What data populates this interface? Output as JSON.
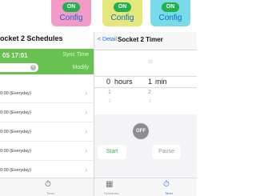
{
  "config_tiles": [
    {
      "toggle": "ON",
      "label": "Config",
      "color": "#f49ac9"
    },
    {
      "toggle": "ON",
      "label": "Config",
      "color": "#e6e77a"
    },
    {
      "toggle": "ON",
      "label": "Config",
      "color": "#79dbe8"
    }
  ],
  "left": {
    "title": "ocket 2 Schedules",
    "active": {
      "datetime": "05 17:01",
      "sync": "Sync Time",
      "modify": "Modify"
    },
    "rows": [
      "0:00 (Everyday)",
      "0:00 (Everyday)",
      "0:00 (Everyday)",
      "0:00 (Everyday)",
      "0:00 (Everyday)"
    ],
    "tab_label": "Timer"
  },
  "right": {
    "back": "< Detail",
    "title": "Socket 2 Timer",
    "hours": {
      "above": "",
      "selected": "0",
      "unit": "hours",
      "below1": "1",
      "below2": "2"
    },
    "minutes": {
      "above": "59",
      "selected": "1",
      "unit": "min",
      "below1": "2",
      "below2": "3"
    },
    "off": "OFF",
    "start": "Start",
    "pause": "Pause",
    "tabs": [
      {
        "label": "Schedules"
      },
      {
        "label": "Timer"
      }
    ]
  }
}
